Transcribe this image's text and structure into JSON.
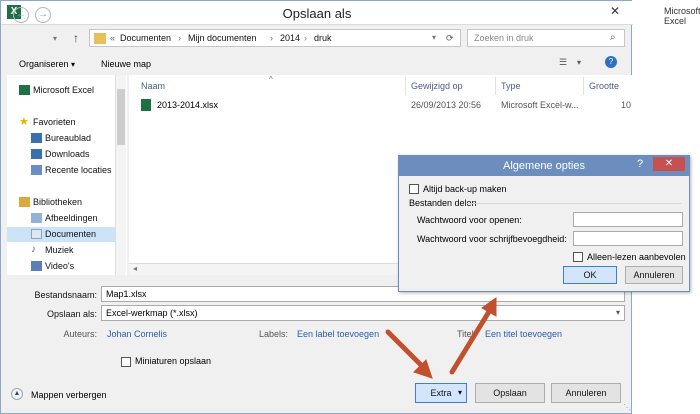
{
  "background_window": {
    "title": "Microsoft Excel"
  },
  "dialog": {
    "title": "Opslaan als",
    "close_glyph": "✕",
    "app_icon_letter": "X"
  },
  "nav": {
    "back_glyph": "←",
    "forward_glyph": "→",
    "up_glyph": "↑",
    "path_prefix": "«",
    "path": [
      "Documenten",
      "Mijn documenten",
      "2014",
      "druk"
    ],
    "path_sep": "›",
    "search_placeholder": "Zoeken in druk"
  },
  "toolbar": {
    "organize": "Organiseren",
    "organize_arrow": "▾",
    "new_folder": "Nieuwe map",
    "view_glyph": "☰",
    "help_glyph": "?"
  },
  "sidebar": {
    "items": [
      {
        "label": "Microsoft Excel",
        "icon": "excel-icon",
        "top": true
      },
      {
        "label": "Favorieten",
        "icon": "star-icon",
        "top": true
      },
      {
        "label": "Bureaublad",
        "icon": "desktop-icon"
      },
      {
        "label": "Downloads",
        "icon": "downloads-icon"
      },
      {
        "label": "Recente locaties",
        "icon": "recent-places-icon"
      },
      {
        "label": "Bibliotheken",
        "icon": "libraries-icon",
        "top": true
      },
      {
        "label": "Afbeeldingen",
        "icon": "pictures-icon"
      },
      {
        "label": "Documenten",
        "icon": "documents-icon",
        "selected": true
      },
      {
        "label": "Muziek",
        "icon": "music-icon"
      },
      {
        "label": "Video's",
        "icon": "videos-icon"
      }
    ]
  },
  "files": {
    "columns": [
      "Naam",
      "Gewijzigd op",
      "Type",
      "Grootte"
    ],
    "rows": [
      {
        "name": "2013-2014.xlsx",
        "modified": "26/09/2013 20:56",
        "type": "Microsoft Excel-w...",
        "size": "10"
      }
    ]
  },
  "form": {
    "filename_label": "Bestandsnaam:",
    "filename_value": "Map1.xlsx",
    "savetype_label": "Opslaan als:",
    "savetype_value": "Excel-werkmap (*.xlsx)",
    "authors_label": "Auteurs:",
    "authors_value": "Johan Cornelis",
    "labels_label": "Labels:",
    "labels_value": "Een label toevoegen",
    "title_label": "Titel:",
    "title_value": "Een titel toevoegen",
    "thumbnails_label": "Miniaturen opslaan"
  },
  "footer": {
    "hide_folders": "Mappen verbergen",
    "tools": "Extra",
    "tools_arrow": "▾",
    "save": "Opslaan",
    "cancel": "Annuleren"
  },
  "general_options": {
    "title": "Algemene opties",
    "help_glyph": "?",
    "close_glyph": "✕",
    "always_backup": "Altijd back-up maken",
    "file_sharing": "Bestanden delen",
    "password_open": "Wachtwoord voor openen:",
    "password_modify": "Wachtwoord voor schrijfbevoegdheid:",
    "read_only": "Alleen-lezen aanbevolen",
    "ok": "OK",
    "cancel": "Annuleren"
  },
  "colors": {
    "accent": "#3c7fd9",
    "excel_green": "#1e7145",
    "annotation_arrow": "#c0502e",
    "options_title": "#6c8ebf"
  }
}
